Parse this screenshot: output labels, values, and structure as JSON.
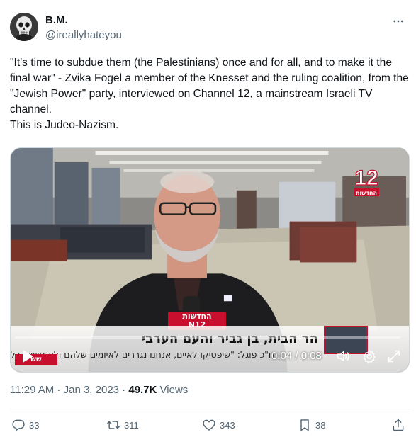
{
  "author": {
    "display_name": "B.M.",
    "handle": "@ireallyhateyou"
  },
  "tweet": {
    "text_lines": [
      "\"It's time to subdue them (the Palestinians) once and for all, and to make it the final war\" - Zvika Fogel a member of the Knesset and the ruling coalition, from the \"Jewish Power\" party, interviewed on Channel 12, a mainstream Israeli TV channel.",
      "This is Judeo-Nazism."
    ]
  },
  "video": {
    "channel_logo_number": "12",
    "channel_logo_text": "החדשות",
    "news_tag_line1": "החדשות",
    "news_tag_line2": "N12",
    "ticker_headline": "הר הבית, בן גביר והעם הערבי",
    "ticker_subline": "ח\"כ פוגל: \"שיפסיקו לאיים, אנחנו נגררים לאיומים שלהם ולא עושים כלום\"",
    "ticker_tag": "שש",
    "progress": 0.0,
    "time_display": "0:04 / 0:08"
  },
  "meta": {
    "time": "11:29 AM",
    "separator": " · ",
    "date": "Jan 3, 2023",
    "views_count": "49.7K",
    "views_label": " Views"
  },
  "actions": {
    "replies": "33",
    "retweets": "311",
    "likes": "343",
    "bookmarks": "38"
  },
  "colors": {
    "text_primary": "#0f1419",
    "text_secondary": "#536471",
    "news_red": "#c8102e"
  }
}
